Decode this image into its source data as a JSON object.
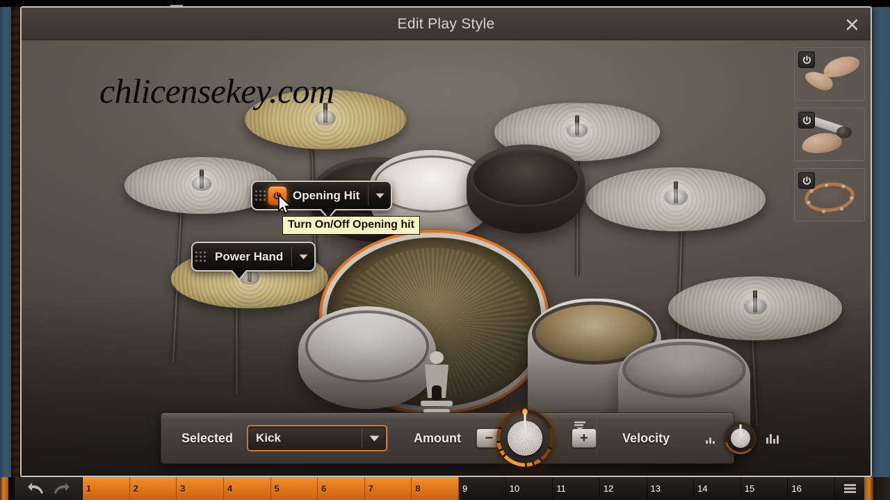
{
  "window": {
    "title": "Edit Play Style",
    "close_icon": "close-icon"
  },
  "watermark": {
    "text": "chlicensekey.com"
  },
  "stage": {
    "badges": [
      {
        "id": "opening-hit",
        "label": "Opening Hit",
        "power_on": true,
        "power_icon": "power-icon",
        "caret_icon": "chevron-down-icon",
        "grip_icon": "drag-handle-icon"
      },
      {
        "id": "power-hand",
        "label": "Power Hand",
        "power_on": false,
        "power_icon": "power-icon",
        "caret_icon": "chevron-down-icon",
        "grip_icon": "drag-handle-icon"
      }
    ],
    "tooltip": {
      "text": "Turn On/Off Opening hit"
    },
    "cursor_icon": "mouse-pointer-icon",
    "selected_piece_highlight_color": "#e8731a"
  },
  "side_panels": [
    {
      "id": "hands",
      "power_icon": "power-icon",
      "thumbnail": "hands-thumbnail"
    },
    {
      "id": "brush",
      "power_icon": "power-icon",
      "thumbnail": "hand-with-brush-thumbnail"
    },
    {
      "id": "tambourine",
      "power_icon": "power-icon",
      "thumbnail": "tambourine-thumbnail"
    }
  ],
  "control_bar": {
    "selected": {
      "label": "Selected",
      "value": "Kick",
      "placeholder": "Kick",
      "caret_icon": "chevron-down-icon",
      "border_color": "#d4762a"
    },
    "amount": {
      "label": "Amount",
      "minus_label": "−",
      "plus_label": "+",
      "knob_icon": "rotary-knob",
      "menu_icon": "list-menu-icon"
    },
    "velocity": {
      "label": "Velocity",
      "low_icon": "bars-low-icon",
      "high_icon": "bars-high-icon",
      "knob_icon": "rotary-knob"
    }
  },
  "timeline": {
    "undo_icon": "undo-arrow-icon",
    "redo_icon": "redo-arrow-icon",
    "tools_icon": "list-menu-icon",
    "selected_range": [
      1,
      8
    ],
    "bars": [
      {
        "number": "1",
        "selected": true
      },
      {
        "number": "2",
        "selected": true
      },
      {
        "number": "3",
        "selected": true
      },
      {
        "number": "4",
        "selected": true
      },
      {
        "number": "5",
        "selected": true
      },
      {
        "number": "6",
        "selected": true
      },
      {
        "number": "7",
        "selected": true
      },
      {
        "number": "8",
        "selected": true
      },
      {
        "number": "9",
        "selected": false
      },
      {
        "number": "10",
        "selected": false
      },
      {
        "number": "11",
        "selected": false
      },
      {
        "number": "12",
        "selected": false
      },
      {
        "number": "13",
        "selected": false
      },
      {
        "number": "14",
        "selected": false
      },
      {
        "number": "15",
        "selected": false
      },
      {
        "number": "16",
        "selected": false
      }
    ]
  },
  "colors": {
    "accent_orange": "#e8731a",
    "dialog_bg": "#585450",
    "titlebar_bg": "#3e3a36",
    "tooltip_bg": "#f7f2c2"
  }
}
